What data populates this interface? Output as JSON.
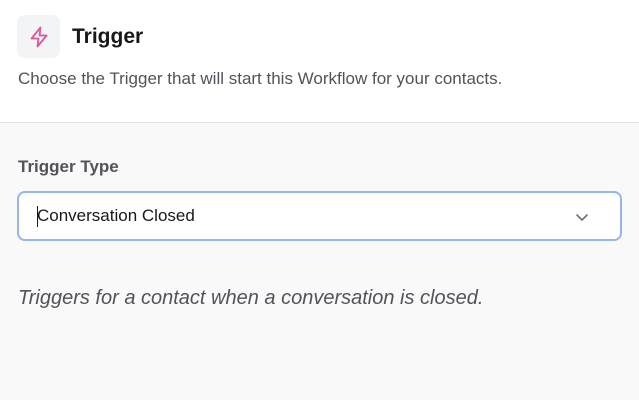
{
  "header": {
    "icon": "lightning-bolt-icon",
    "title": "Trigger",
    "description": "Choose the Trigger that will start this Workflow for your contacts."
  },
  "trigger_type": {
    "label": "Trigger Type",
    "selected_value": "Conversation Closed",
    "icon": "chevron-down-icon"
  },
  "help_text": "Triggers for a contact when a conversation is closed.",
  "colors": {
    "icon_accent": "#e0559a",
    "focus_border": "#93b5f0"
  }
}
